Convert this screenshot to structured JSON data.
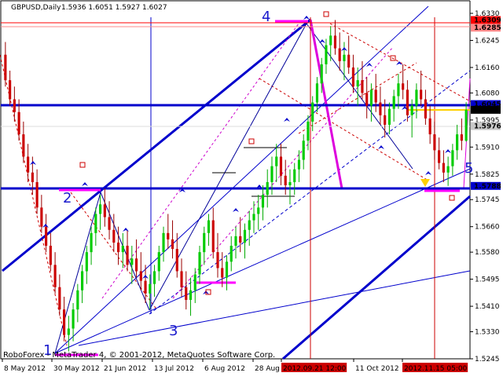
{
  "chart_data": {
    "type": "candlestick",
    "symbol": "GBPUSD,Daily",
    "ohlc_header": "1.5936 1.6051 1.5927 1.6027",
    "copyright": "RoboForex - MetaTrader 4, © 2001-2012, MetaQuotes Software Corp.",
    "ylim": [
      1.5245,
      1.633
    ],
    "y_ticks": [
      1.633,
      1.6245,
      1.616,
      1.608,
      1.5995,
      1.591,
      1.5825,
      1.5745,
      1.566,
      1.558,
      1.5495,
      1.541,
      1.533,
      1.5245
    ],
    "x_ticks": [
      "8 May 2012",
      "30 May 2012",
      "21 Jun 2012",
      "13 Jul 2012",
      "6 Aug 2012",
      "28 Aug",
      "2012.09.21 12:00",
      "11 Oct 2012",
      "2012.11.15 05:00"
    ],
    "price_labels": [
      {
        "value": "1.6309",
        "color": "#ff0000"
      },
      {
        "value": "1.6285",
        "color": "#ff8a8a"
      },
      {
        "value": "1.6045",
        "color": "#0000cc"
      },
      {
        "value": "1.6027",
        "color": "#000000"
      },
      {
        "value": "1.5976",
        "color": "#c8c8c8"
      },
      {
        "value": "1.5788",
        "color": "#0000cc"
      }
    ],
    "wave_labels": [
      "1",
      "2",
      "3",
      "4",
      "5"
    ],
    "candles": [
      [
        1.62,
        1.624,
        1.61,
        1.612
      ],
      [
        1.612,
        1.615,
        1.604,
        1.606
      ],
      [
        1.606,
        1.61,
        1.599,
        1.602
      ],
      [
        1.602,
        1.606,
        1.593,
        1.595
      ],
      [
        1.595,
        1.599,
        1.586,
        1.588
      ],
      [
        1.588,
        1.592,
        1.58,
        1.583
      ],
      [
        1.583,
        1.588,
        1.576,
        1.58
      ],
      [
        1.58,
        1.584,
        1.57,
        1.572
      ],
      [
        1.572,
        1.576,
        1.564,
        1.566
      ],
      [
        1.566,
        1.57,
        1.558,
        1.56
      ],
      [
        1.56,
        1.564,
        1.552,
        1.554
      ],
      [
        1.554,
        1.558,
        1.545,
        1.547
      ],
      [
        1.547,
        1.551,
        1.538,
        1.54
      ],
      [
        1.54,
        1.544,
        1.53,
        1.532
      ],
      [
        1.532,
        1.538,
        1.5268,
        1.534
      ],
      [
        1.534,
        1.542,
        1.53,
        1.54
      ],
      [
        1.54,
        1.548,
        1.536,
        1.546
      ],
      [
        1.546,
        1.554,
        1.542,
        1.552
      ],
      [
        1.552,
        1.56,
        1.548,
        1.558
      ],
      [
        1.558,
        1.566,
        1.554,
        1.564
      ],
      [
        1.564,
        1.572,
        1.56,
        1.57
      ],
      [
        1.57,
        1.576,
        1.565,
        1.573
      ],
      [
        1.573,
        1.578,
        1.566,
        1.569
      ],
      [
        1.569,
        1.574,
        1.562,
        1.565
      ],
      [
        1.565,
        1.57,
        1.558,
        1.561
      ],
      [
        1.561,
        1.566,
        1.554,
        1.558
      ],
      [
        1.558,
        1.564,
        1.553,
        1.56
      ],
      [
        1.56,
        1.565,
        1.552,
        1.554
      ],
      [
        1.554,
        1.56,
        1.548,
        1.556
      ],
      [
        1.556,
        1.562,
        1.55,
        1.552
      ],
      [
        1.552,
        1.558,
        1.546,
        1.549
      ],
      [
        1.549,
        1.554,
        1.542,
        1.545
      ],
      [
        1.545,
        1.551,
        1.54,
        1.548
      ],
      [
        1.548,
        1.554,
        1.544,
        1.552
      ],
      [
        1.552,
        1.56,
        1.549,
        1.558
      ],
      [
        1.558,
        1.566,
        1.555,
        1.564
      ],
      [
        1.564,
        1.57,
        1.559,
        1.562
      ],
      [
        1.562,
        1.568,
        1.556,
        1.559
      ],
      [
        1.559,
        1.564,
        1.55,
        1.552
      ],
      [
        1.552,
        1.556,
        1.544,
        1.547
      ],
      [
        1.547,
        1.552,
        1.54,
        1.543
      ],
      [
        1.543,
        1.55,
        1.538,
        1.546
      ],
      [
        1.546,
        1.553,
        1.542,
        1.551
      ],
      [
        1.551,
        1.56,
        1.548,
        1.558
      ],
      [
        1.558,
        1.566,
        1.554,
        1.564
      ],
      [
        1.564,
        1.57,
        1.56,
        1.568
      ],
      [
        1.568,
        1.572,
        1.556,
        1.558
      ],
      [
        1.558,
        1.564,
        1.55,
        1.553
      ],
      [
        1.553,
        1.558,
        1.547,
        1.55
      ],
      [
        1.55,
        1.557,
        1.546,
        1.555
      ],
      [
        1.555,
        1.563,
        1.552,
        1.56
      ],
      [
        1.56,
        1.566,
        1.556,
        1.563
      ],
      [
        1.563,
        1.569,
        1.558,
        1.561
      ],
      [
        1.561,
        1.567,
        1.556,
        1.565
      ],
      [
        1.565,
        1.571,
        1.56,
        1.568
      ],
      [
        1.568,
        1.574,
        1.564,
        1.57
      ],
      [
        1.57,
        1.576,
        1.565,
        1.572
      ],
      [
        1.572,
        1.579,
        1.568,
        1.576
      ],
      [
        1.576,
        1.584,
        1.572,
        1.58
      ],
      [
        1.58,
        1.588,
        1.576,
        1.585
      ],
      [
        1.585,
        1.592,
        1.58,
        1.588
      ],
      [
        1.588,
        1.592,
        1.579,
        1.582
      ],
      [
        1.582,
        1.587,
        1.576,
        1.579
      ],
      [
        1.579,
        1.584,
        1.573,
        1.58
      ],
      [
        1.58,
        1.586,
        1.576,
        1.584
      ],
      [
        1.584,
        1.59,
        1.58,
        1.587
      ],
      [
        1.587,
        1.595,
        1.584,
        1.593
      ],
      [
        1.593,
        1.601,
        1.59,
        1.599
      ],
      [
        1.599,
        1.607,
        1.596,
        1.605
      ],
      [
        1.605,
        1.613,
        1.602,
        1.611
      ],
      [
        1.611,
        1.619,
        1.608,
        1.617
      ],
      [
        1.617,
        1.625,
        1.614,
        1.623
      ],
      [
        1.623,
        1.629,
        1.618,
        1.626
      ],
      [
        1.626,
        1.6309,
        1.62,
        1.622
      ],
      [
        1.622,
        1.627,
        1.615,
        1.618
      ],
      [
        1.618,
        1.624,
        1.612,
        1.62
      ],
      [
        1.62,
        1.626,
        1.614,
        1.616
      ],
      [
        1.616,
        1.62,
        1.608,
        1.61
      ],
      [
        1.61,
        1.616,
        1.604,
        1.612
      ],
      [
        1.612,
        1.618,
        1.606,
        1.608
      ],
      [
        1.608,
        1.613,
        1.6,
        1.604
      ],
      [
        1.604,
        1.611,
        1.599,
        1.609
      ],
      [
        1.609,
        1.614,
        1.602,
        1.605
      ],
      [
        1.605,
        1.61,
        1.598,
        1.601
      ],
      [
        1.601,
        1.606,
        1.594,
        1.598
      ],
      [
        1.598,
        1.605,
        1.595,
        1.603
      ],
      [
        1.603,
        1.609,
        1.599,
        1.607
      ],
      [
        1.607,
        1.614,
        1.603,
        1.611
      ],
      [
        1.611,
        1.617,
        1.606,
        1.609
      ],
      [
        1.609,
        1.612,
        1.599,
        1.601
      ],
      [
        1.601,
        1.606,
        1.594,
        1.604
      ],
      [
        1.604,
        1.611,
        1.6,
        1.609
      ],
      [
        1.609,
        1.615,
        1.604,
        1.606
      ],
      [
        1.606,
        1.609,
        1.598,
        1.6
      ],
      [
        1.6,
        1.604,
        1.592,
        1.595
      ],
      [
        1.595,
        1.599,
        1.587,
        1.59
      ],
      [
        1.59,
        1.594,
        1.584,
        1.586
      ],
      [
        1.586,
        1.59,
        1.58,
        1.583
      ],
      [
        1.583,
        1.588,
        1.5788,
        1.585
      ],
      [
        1.585,
        1.592,
        1.582,
        1.59
      ],
      [
        1.59,
        1.598,
        1.587,
        1.595
      ],
      [
        1.595,
        1.6,
        1.59,
        1.593
      ],
      [
        1.593,
        1.6051,
        1.5927,
        1.6027
      ]
    ]
  }
}
